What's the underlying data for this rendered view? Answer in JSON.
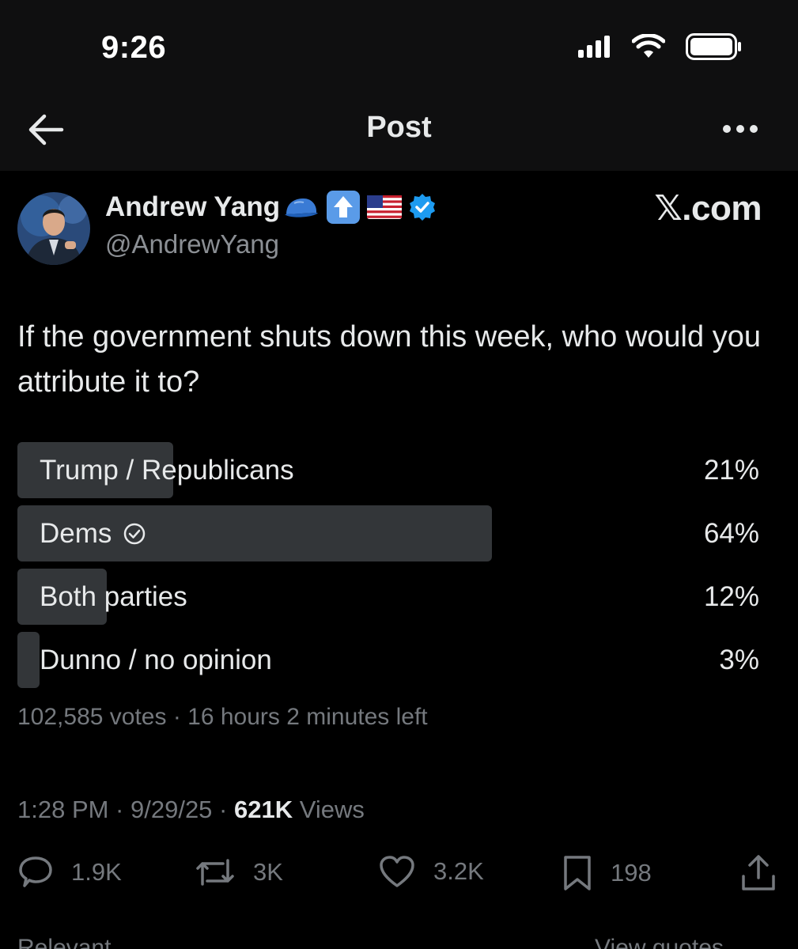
{
  "status_bar": {
    "time": "9:26"
  },
  "navbar": {
    "title": "Post"
  },
  "author": {
    "name": "Andrew Yang",
    "handle": "@AndrewYang",
    "badge_icons": [
      "blue-cap-icon",
      "up-arrow-icon",
      "us-flag-icon",
      "verified-badge-icon"
    ]
  },
  "watermark": "𝕏.com",
  "post": {
    "text": "If the government shuts down this week, who would you attribute it to?"
  },
  "poll": {
    "options": [
      {
        "label": "Trump / Republicans",
        "percent_text": "21%",
        "percent": 21,
        "selected": false
      },
      {
        "label": "Dems",
        "percent_text": "64%",
        "percent": 64,
        "selected": true
      },
      {
        "label": "Both parties",
        "percent_text": "12%",
        "percent": 12,
        "selected": false
      },
      {
        "label": "Dunno / no opinion",
        "percent_text": "3%",
        "percent": 3,
        "selected": false
      }
    ],
    "meta": "102,585 votes · 16 hours 2 minutes left"
  },
  "timestamp": {
    "time_date": "1:28 PM · 9/29/25 · ",
    "views_count": "621K",
    "views_label": " Views"
  },
  "actions": {
    "replies": "1.9K",
    "reposts": "3K",
    "likes": "3.2K",
    "bookmarks": "198"
  },
  "bottom": {
    "left": "Relevant",
    "right": "View quotes"
  },
  "colors": {
    "background": "#000000",
    "header_bg": "#0f0f10",
    "poll_fill": "#333639",
    "verified": "#1d9bf0",
    "muted": "#75797e"
  }
}
